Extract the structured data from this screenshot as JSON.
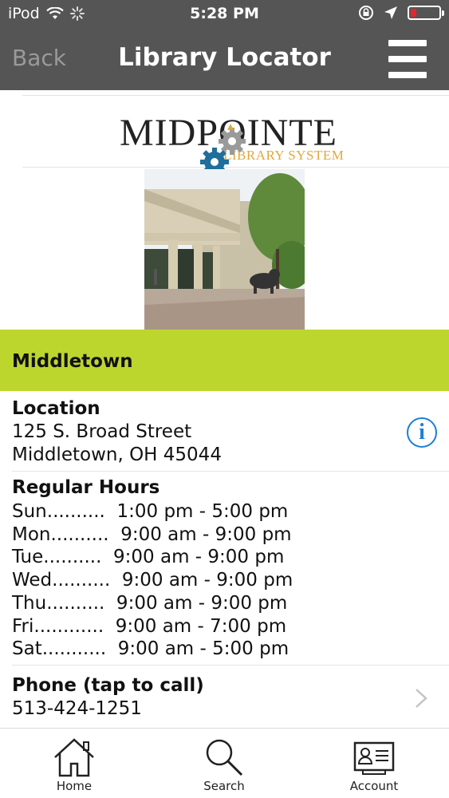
{
  "status_bar": {
    "carrier": "iPod",
    "time": "5:28 PM",
    "battery_level": 0.2,
    "battery_color": "#e4262b"
  },
  "nav": {
    "back_label": "Back",
    "title": "Library Locator",
    "menu_icon": "hamburger-menu-icon"
  },
  "logo": {
    "wordmark": "MIDPOINTE",
    "subtitle": "LIBRARY SYSTEM",
    "subtitle_color": "#e3a73a"
  },
  "branch": {
    "name": "Middletown",
    "header_color": "#bdd62e",
    "location": {
      "title": "Location",
      "address_line1": "125 S. Broad Street",
      "address_line2": "Middletown, OH 45044"
    },
    "hours": {
      "title": "Regular Hours",
      "rows": [
        "Sun..........  1:00 pm - 5:00 pm",
        "Mon..........  9:00 am - 9:00 pm",
        "Tue..........  9:00 am - 9:00 pm",
        "Wed..........  9:00 am - 9:00 pm",
        "Thu..........  9:00 am - 9:00 pm",
        "Fri............  9:00 am - 7:00 pm",
        "Sat...........  9:00 am - 5:00 pm"
      ]
    },
    "phone": {
      "title": "Phone (tap to call)",
      "number": "513-424-1251"
    }
  },
  "tabs": [
    {
      "label": "Home",
      "icon": "home-icon"
    },
    {
      "label": "Search",
      "icon": "search-icon"
    },
    {
      "label": "Account",
      "icon": "library-card-icon"
    }
  ],
  "accent_color": "#1b7fd6"
}
